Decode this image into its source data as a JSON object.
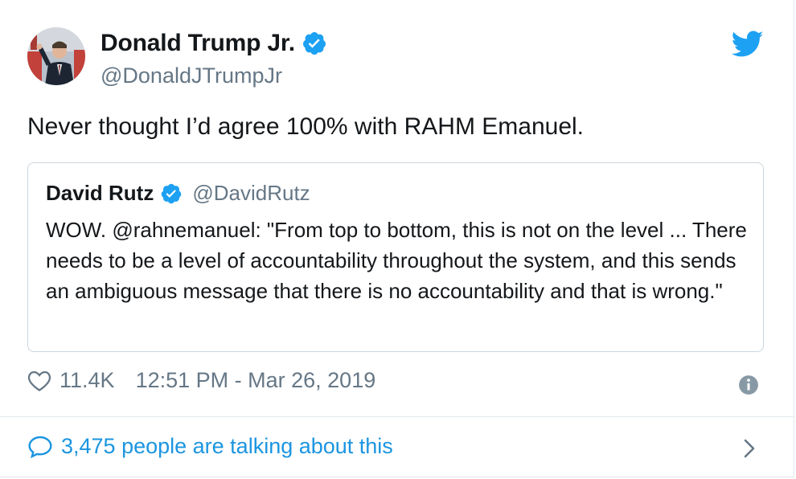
{
  "tweet": {
    "author_name": "Donald Trump Jr.",
    "author_handle": "@DonaldJTrumpJr",
    "text": "Never thought I’d agree 100% with RAHM Emanuel.",
    "likes": "11.4K",
    "timestamp": "12:51 PM - Mar 26, 2019",
    "talking": "3,475 people are talking about this"
  },
  "quote": {
    "author_name": "David Rutz",
    "author_handle": "@DavidRutz",
    "text": "WOW. @rahnemanuel: \"From top to bottom, this is not on the level ... There needs to be a level of accountability throughout the system, and this sends an ambiguous message that there is no accountability and that is wrong.\""
  },
  "icons": {
    "brand": "twitter-bird-icon",
    "verified": "verified-badge-icon",
    "like": "heart-icon",
    "info": "info-icon",
    "reply": "speech-bubble-icon",
    "more": "chevron-right-icon"
  },
  "colors": {
    "accent": "#1da1f2",
    "link": "#1b95e0",
    "muted": "#657786",
    "text": "#14171a",
    "border": "#ccd6dd"
  }
}
